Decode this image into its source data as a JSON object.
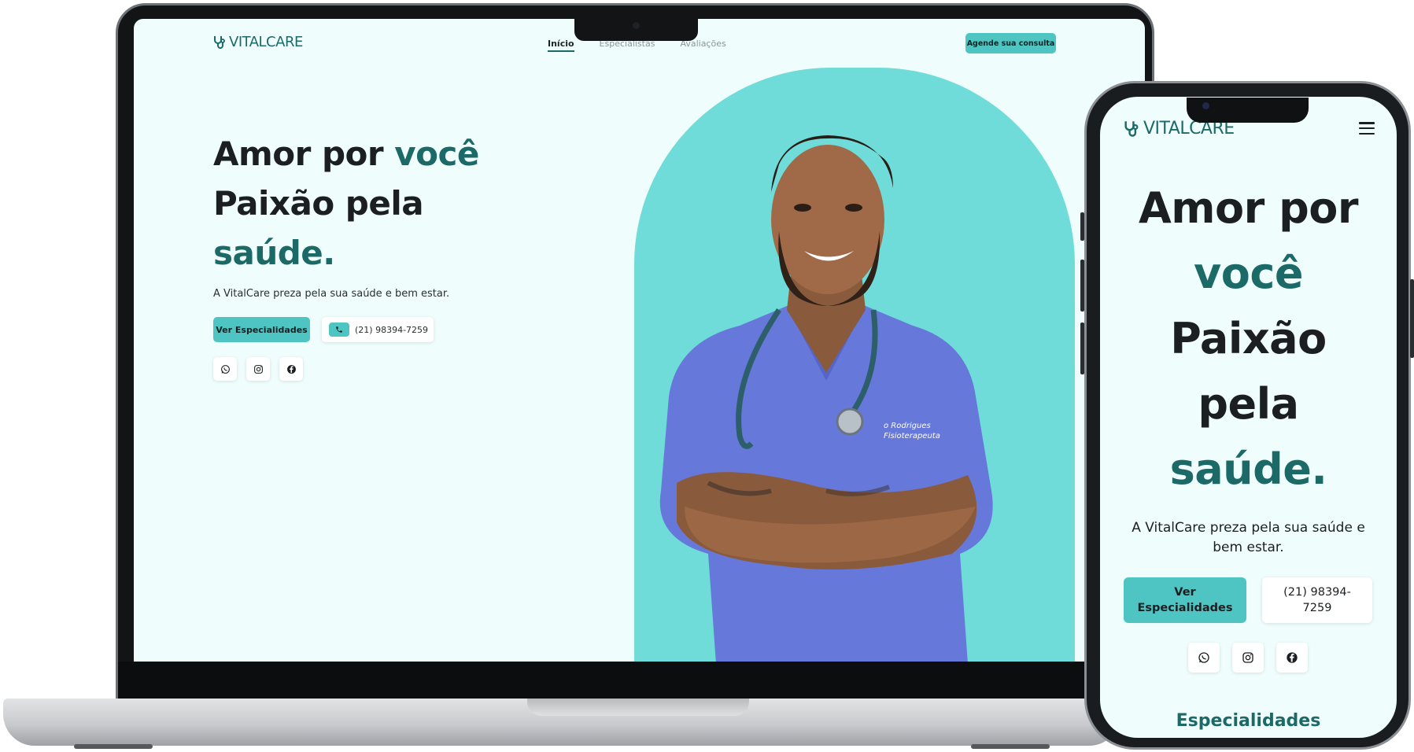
{
  "brand": {
    "name": "VITALCARE",
    "accent": "#1c6a68",
    "primary": "#4ec5c3",
    "hero_bg": "#6fdcd9"
  },
  "nav": {
    "items": [
      {
        "label": "Início"
      },
      {
        "label": "Especialistas"
      },
      {
        "label": "Avaliações"
      }
    ],
    "cta": "Agende sua consulta"
  },
  "hero": {
    "line1_dark": "Amor por ",
    "line1_accent": "você",
    "line2_dark": "Paixão pela",
    "line3_accent": "saúde.",
    "subtitle": "A VitalCare preza pela sua saúde e bem estar.",
    "primary_button": "Ver Especialidades",
    "phone": "(21) 98394-7259"
  },
  "badge": {
    "line1": "o Rodrigues",
    "line2": "Fisioterapeuta"
  },
  "mobile": {
    "title_l1": "Amor por",
    "title_l2": "você",
    "title_l3": "Paixão",
    "title_l4": "pela",
    "title_l5": "saúde.",
    "primary_l1": "Ver",
    "primary_l2": "Especialidades",
    "phone_l1": "(21) 98394-",
    "phone_l2": "7259",
    "section_title": "Especialidades"
  },
  "icons": [
    "stethoscope-icon",
    "phone-icon",
    "whatsapp-icon",
    "instagram-icon",
    "facebook-icon",
    "hamburger-menu-icon"
  ]
}
